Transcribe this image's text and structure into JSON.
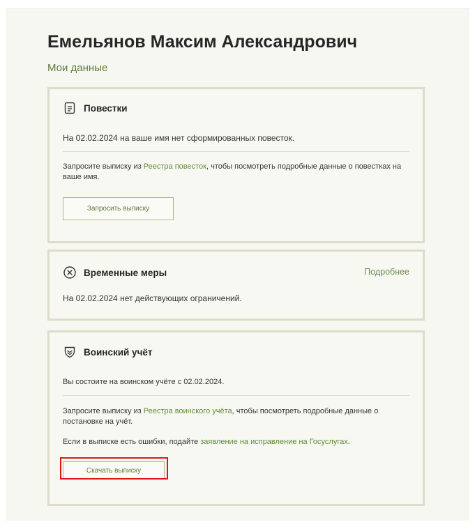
{
  "header": {
    "name": "Емельянов Максим Александрович",
    "subtitle": "Мои данные"
  },
  "summons": {
    "title": "Повестки",
    "status": "На 02.02.2024 на ваше имя нет сформированных повесток.",
    "request_prefix": "Запросите выписку из ",
    "request_link": "Реестра повесток",
    "request_suffix": ", чтобы посмотреть подробные данные о повестках на ваше имя.",
    "button_label": "Запросить выписку",
    "icon": "document-icon"
  },
  "measures": {
    "title": "Временные меры",
    "more_link": "Подробнее",
    "status": "На 02.02.2024 нет действующих ограничений.",
    "icon": "close-circle-icon"
  },
  "military": {
    "title": "Воинский учёт",
    "status": "Вы состоите на воинском учёте с 02.02.2024.",
    "request_prefix": "Запросите выписку из ",
    "request_link": "Реестра воинского учёта",
    "request_suffix": ", чтобы посмотреть подробные данные о постановке на учёт.",
    "errors_prefix": "Если в выписке есть ошибки, подайте ",
    "errors_link": "заявление на исправление на Госуслугах",
    "errors_suffix": ".",
    "button_label": "Скачать выписку",
    "icon": "shield-icon"
  },
  "colors": {
    "accent": "#5e8a36",
    "highlight": "#e0151b"
  }
}
